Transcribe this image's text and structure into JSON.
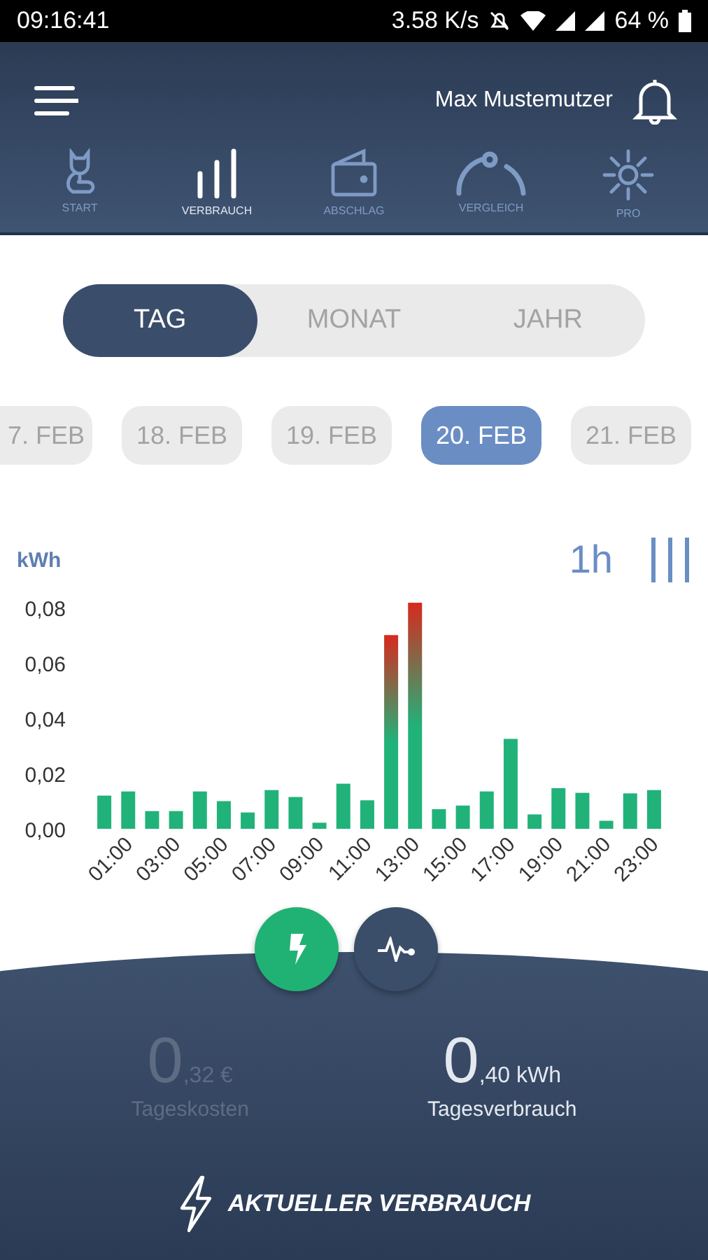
{
  "status_bar": {
    "time": "09:16:41",
    "speed": "3.58 K/s",
    "battery": "64 %"
  },
  "header": {
    "user_name": "Max Mustemutzer"
  },
  "nav": [
    {
      "label": "START",
      "selected": false
    },
    {
      "label": "VERBRAUCH",
      "selected": true
    },
    {
      "label": "ABSCHLAG",
      "selected": false
    },
    {
      "label": "VERGLEICH",
      "selected": false
    },
    {
      "label": "PRO",
      "selected": false
    }
  ],
  "period_tabs": [
    {
      "label": "TAG",
      "selected": true
    },
    {
      "label": "MONAT",
      "selected": false
    },
    {
      "label": "JAHR",
      "selected": false
    }
  ],
  "dates": [
    {
      "label": "7. FEB",
      "selected": false
    },
    {
      "label": "18. FEB",
      "selected": false
    },
    {
      "label": "19. FEB",
      "selected": false
    },
    {
      "label": "20. FEB",
      "selected": true
    },
    {
      "label": "21. FEB",
      "selected": false
    }
  ],
  "chart_header": {
    "unit": "kWh",
    "interval": "1h"
  },
  "chart_data": {
    "type": "bar",
    "xlim": [
      -0.5,
      23.5
    ],
    "x": [
      0,
      1,
      2,
      3,
      4,
      5,
      6,
      7,
      8,
      9,
      10,
      11,
      12,
      13,
      14,
      15,
      16,
      17,
      18,
      19,
      20,
      21,
      22,
      23
    ],
    "series": [
      {
        "color": "#21b27a",
        "values": [
          0.012,
          0.0135,
          0.0064,
          0.0064,
          0.0135,
          0.01,
          0.0059,
          0.014,
          0.0115,
          0.0022,
          0.0163,
          0.0103,
          0.07,
          0.0817,
          0.0071,
          0.0084,
          0.0135,
          0.0325,
          0.0052,
          0.0147,
          0.013,
          0.0029,
          0.0128,
          0.014
        ]
      }
    ],
    "ylim": [
      0,
      0.085
    ],
    "yticks": [
      {
        "value": 0,
        "label": "0,00"
      },
      {
        "value": 0.02,
        "label": "0,02"
      },
      {
        "value": 0.04,
        "label": "0,04"
      },
      {
        "value": 0.06,
        "label": "0,06"
      },
      {
        "value": 0.08,
        "label": "0,08"
      }
    ],
    "xticks": [
      {
        "value": 1,
        "label": "01:00"
      },
      {
        "value": 3,
        "label": "03:00"
      },
      {
        "value": 5,
        "label": "05:00"
      },
      {
        "value": 7,
        "label": "07:00"
      },
      {
        "value": 9,
        "label": "09:00"
      },
      {
        "value": 11,
        "label": "11:00"
      },
      {
        "value": 13,
        "label": "13:00"
      },
      {
        "value": 15,
        "label": "15:00"
      },
      {
        "value": 17,
        "label": "17:00"
      },
      {
        "value": 19,
        "label": "19:00"
      },
      {
        "value": 21,
        "label": "21:00"
      },
      {
        "value": 23,
        "label": "23:00"
      }
    ]
  },
  "mode_buttons": [
    {
      "selected": true
    },
    {
      "selected": false
    }
  ],
  "stats": [
    {
      "integer": "0",
      "fraction": ",32 €",
      "label": "Tageskosten",
      "dimmed": true
    },
    {
      "integer": "0",
      "fraction": ",40 kWh",
      "label": "Tagesverbrauch",
      "dimmed": false
    }
  ],
  "footer": {
    "label": "AKTUELLER VERBRAUCH"
  }
}
